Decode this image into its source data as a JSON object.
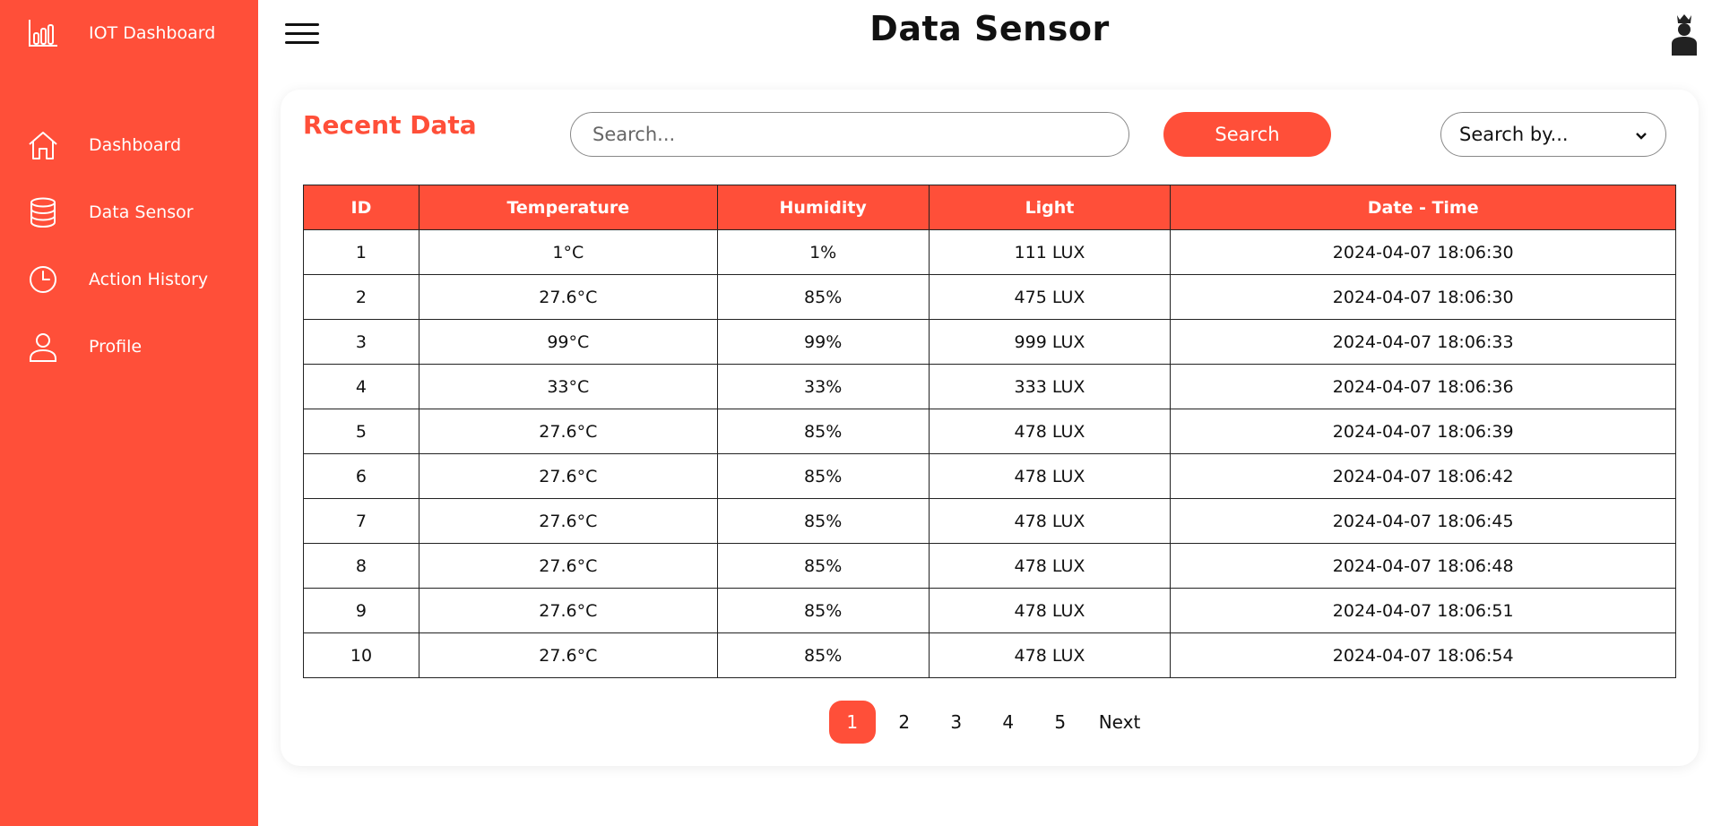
{
  "app": {
    "brand": "IOT Dashboard",
    "page_title": "Data Sensor",
    "accent_color": "#ff4f39"
  },
  "sidebar": {
    "items": [
      {
        "label": "Dashboard",
        "icon": "home-icon"
      },
      {
        "label": "Data Sensor",
        "icon": "database-icon"
      },
      {
        "label": "Action History",
        "icon": "clock-icon"
      },
      {
        "label": "Profile",
        "icon": "user-icon"
      }
    ]
  },
  "card": {
    "title": "Recent Data",
    "search": {
      "placeholder": "Search...",
      "value": ""
    },
    "search_button": "Search",
    "search_by": {
      "selected": "Search by..."
    }
  },
  "table": {
    "headers": [
      "ID",
      "Temperature",
      "Humidity",
      "Light",
      "Date - Time"
    ],
    "rows": [
      [
        "1",
        "1°C",
        "1%",
        "111 LUX",
        "2024-04-07 18:06:30"
      ],
      [
        "2",
        "27.6°C",
        "85%",
        "475 LUX",
        "2024-04-07 18:06:30"
      ],
      [
        "3",
        "99°C",
        "99%",
        "999 LUX",
        "2024-04-07 18:06:33"
      ],
      [
        "4",
        "33°C",
        "33%",
        "333 LUX",
        "2024-04-07 18:06:36"
      ],
      [
        "5",
        "27.6°C",
        "85%",
        "478 LUX",
        "2024-04-07 18:06:39"
      ],
      [
        "6",
        "27.6°C",
        "85%",
        "478 LUX",
        "2024-04-07 18:06:42"
      ],
      [
        "7",
        "27.6°C",
        "85%",
        "478 LUX",
        "2024-04-07 18:06:45"
      ],
      [
        "8",
        "27.6°C",
        "85%",
        "478 LUX",
        "2024-04-07 18:06:48"
      ],
      [
        "9",
        "27.6°C",
        "85%",
        "478 LUX",
        "2024-04-07 18:06:51"
      ],
      [
        "10",
        "27.6°C",
        "85%",
        "478 LUX",
        "2024-04-07 18:06:54"
      ]
    ]
  },
  "pagination": {
    "pages": [
      "1",
      "2",
      "3",
      "4",
      "5"
    ],
    "current": "1",
    "next_label": "Next"
  }
}
